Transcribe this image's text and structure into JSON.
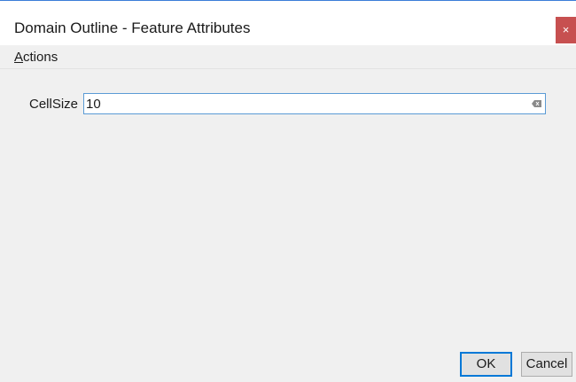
{
  "window": {
    "title": "Domain Outline - Feature Attributes",
    "close_label": "×"
  },
  "menu": {
    "actions_mnemonic": "A",
    "actions_rest": "ctions"
  },
  "form": {
    "cellsize_label": "CellSize",
    "cellsize_value": "10"
  },
  "buttons": {
    "ok_label": "OK",
    "cancel_label": "Cancel"
  },
  "icons": {
    "clear": "clear-input-icon",
    "close": "close-icon"
  },
  "colors": {
    "accent": "#0078d7",
    "close_button": "#c75050",
    "input_border": "#5b9bd5"
  }
}
